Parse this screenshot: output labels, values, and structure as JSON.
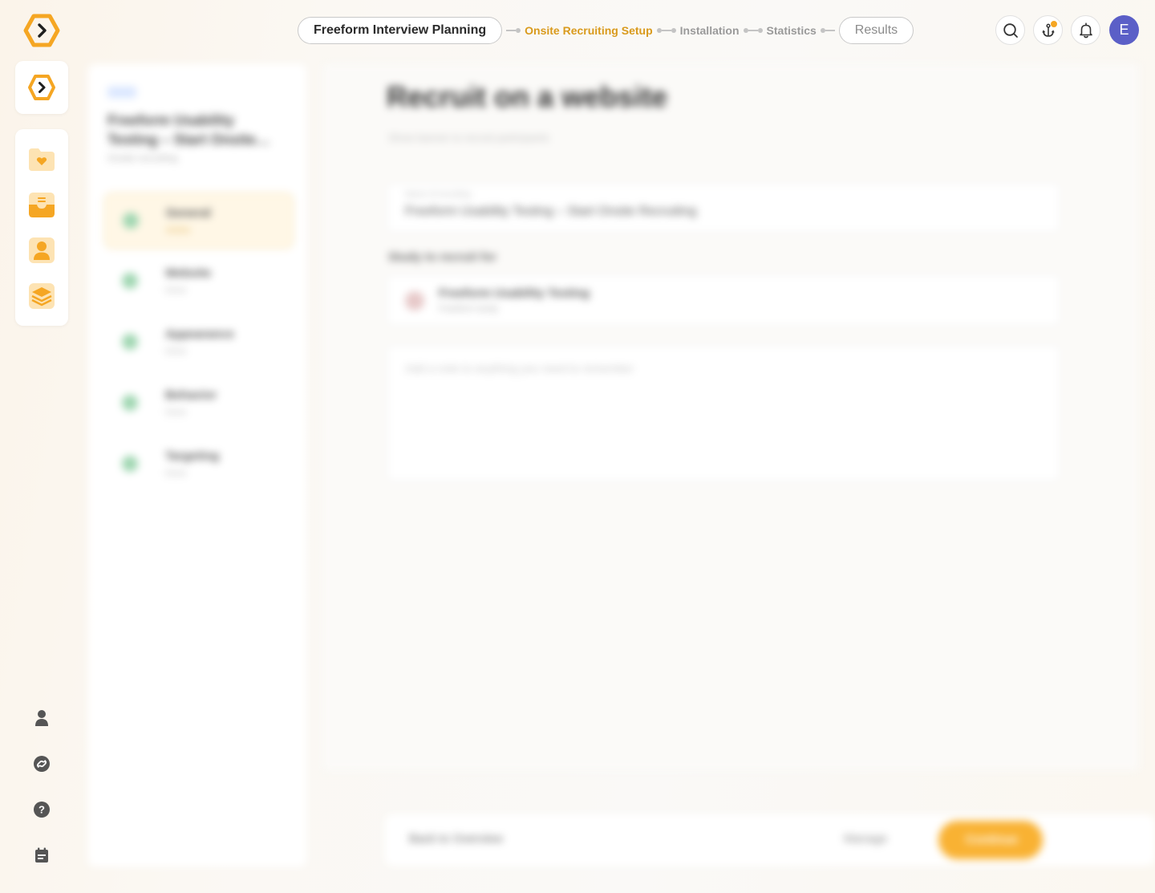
{
  "colors": {
    "accent": "#f5a623",
    "active_step": "#d99a1c",
    "avatar_bg": "#5b5fc7",
    "cta": "#f9b233"
  },
  "stepper": {
    "steps": [
      {
        "label": "Freeform Interview Planning",
        "state": "completed"
      },
      {
        "label": "Onsite Recruiting Setup",
        "state": "active"
      },
      {
        "label": "Installation",
        "state": "upcoming"
      },
      {
        "label": "Statistics",
        "state": "upcoming"
      },
      {
        "label": "Results",
        "state": "upcoming"
      }
    ]
  },
  "header": {
    "avatar_initial": "E",
    "actions": [
      "search-icon",
      "anchor-icon",
      "bell-icon"
    ],
    "anchor_has_notification": true
  },
  "sidebar": {
    "nav_icons": [
      "folder-heart-icon",
      "inbox-icon",
      "person-card-icon",
      "layers-icon"
    ],
    "bottom_icons": [
      "user-icon",
      "integrations-icon",
      "help-icon",
      "checklist-icon"
    ]
  },
  "workspace": {
    "project_title": "Freeform Usability Testing – Start Onsite…",
    "project_subtitle": "Onsite recruiting",
    "steps": [
      {
        "label": "General",
        "sub": "Active"
      },
      {
        "label": "Website",
        "sub": "Done"
      },
      {
        "label": "Appearance",
        "sub": "Done"
      },
      {
        "label": "Behavior",
        "sub": "Done"
      },
      {
        "label": "Targeting",
        "sub": "Done"
      }
    ],
    "heading": "Recruit on a website",
    "heading_sub": "Show banner to recruit participants",
    "name_label": "Name of recruiting",
    "name_value": "Freeform Usability Testing – Start Onsite Recruiting",
    "section_label": "Study to recruit for",
    "study_title": "Freeform Usability Testing",
    "study_meta": "Freeform study",
    "notes_placeholder": "Add a note to anything you need to remember",
    "back_label": "Back to Overview",
    "secondary_label": "Manage",
    "primary_label": "Continue"
  }
}
